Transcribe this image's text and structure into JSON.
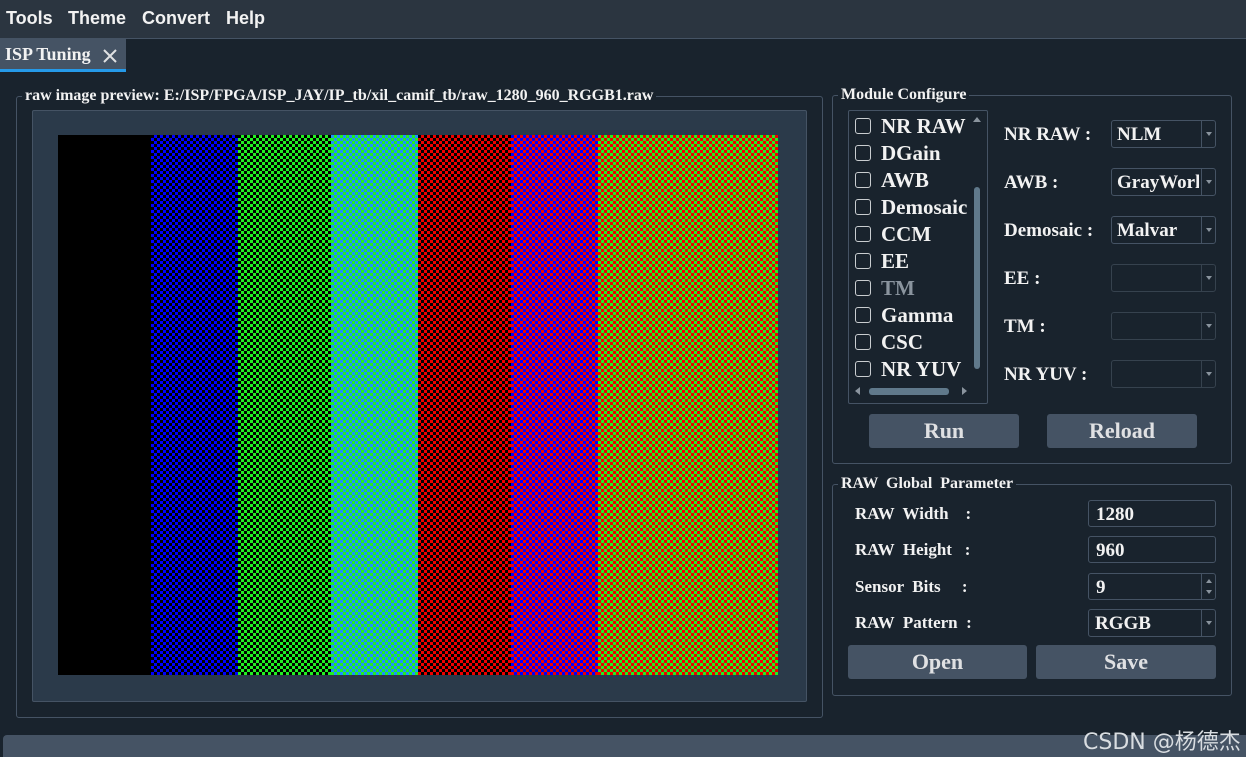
{
  "menubar": {
    "items": [
      "Tools",
      "Theme",
      "Convert",
      "Help"
    ]
  },
  "tab": {
    "label": "ISP Tuning"
  },
  "preview": {
    "title": "raw image preview: E:/ISP/FPGA/ISP_JAY/IP_tb/xil_camif_tb/raw_1280_960_RGGB1.raw",
    "stripes": [
      {
        "name": "black",
        "c1": "#000000",
        "c2": "#000000"
      },
      {
        "name": "blue",
        "c1": "#0000ff",
        "c2": "#000000"
      },
      {
        "name": "green",
        "c1": "#22ee22",
        "c2": "#000000"
      },
      {
        "name": "cyan",
        "c1": "#22ee22",
        "c2": "#1e90ff"
      },
      {
        "name": "red",
        "c1": "#ee0000",
        "c2": "#000000"
      },
      {
        "name": "magenta",
        "c1": "#ee0000",
        "c2": "#0000ff"
      },
      {
        "name": "yellow",
        "c1": "#ee0000",
        "c2": "#22ee22"
      }
    ]
  },
  "module": {
    "title": "Module Configure",
    "list": [
      {
        "label": "NR RAW",
        "enabled": true
      },
      {
        "label": "DGain",
        "enabled": true
      },
      {
        "label": "AWB",
        "enabled": true
      },
      {
        "label": "Demosaic",
        "enabled": true
      },
      {
        "label": "CCM",
        "enabled": true
      },
      {
        "label": "EE",
        "enabled": true
      },
      {
        "label": "TM",
        "enabled": false
      },
      {
        "label": "Gamma",
        "enabled": true
      },
      {
        "label": "CSC",
        "enabled": true
      },
      {
        "label": "NR YUV",
        "enabled": true
      }
    ],
    "configs": [
      {
        "label": "NR RAW :",
        "value": "NLM",
        "enabled": true
      },
      {
        "label": "AWB :",
        "value": "GrayWorld",
        "enabled": true
      },
      {
        "label": "Demosaic :",
        "value": "Malvar",
        "enabled": true
      },
      {
        "label": "EE :",
        "value": "",
        "enabled": false
      },
      {
        "label": "TM :",
        "value": "",
        "enabled": false
      },
      {
        "label": "NR YUV :",
        "value": "",
        "enabled": false
      }
    ],
    "run_label": "Run",
    "reload_label": "Reload"
  },
  "raw_params": {
    "title": "RAW  Global  Parameter",
    "width_label": "RAW  Width    :",
    "width_value": "1280",
    "height_label": "RAW  Height   :",
    "height_value": "960",
    "bits_label": "Sensor  Bits     :",
    "bits_value": "9",
    "pattern_label": "RAW  Pattern  :",
    "pattern_value": "RGGB",
    "open_label": "Open",
    "save_label": "Save"
  },
  "watermark": "CSDN @杨德杰",
  "colors": {
    "accent": "#259ae9",
    "background": "#19232d",
    "button": "#455364",
    "border": "#455364"
  }
}
